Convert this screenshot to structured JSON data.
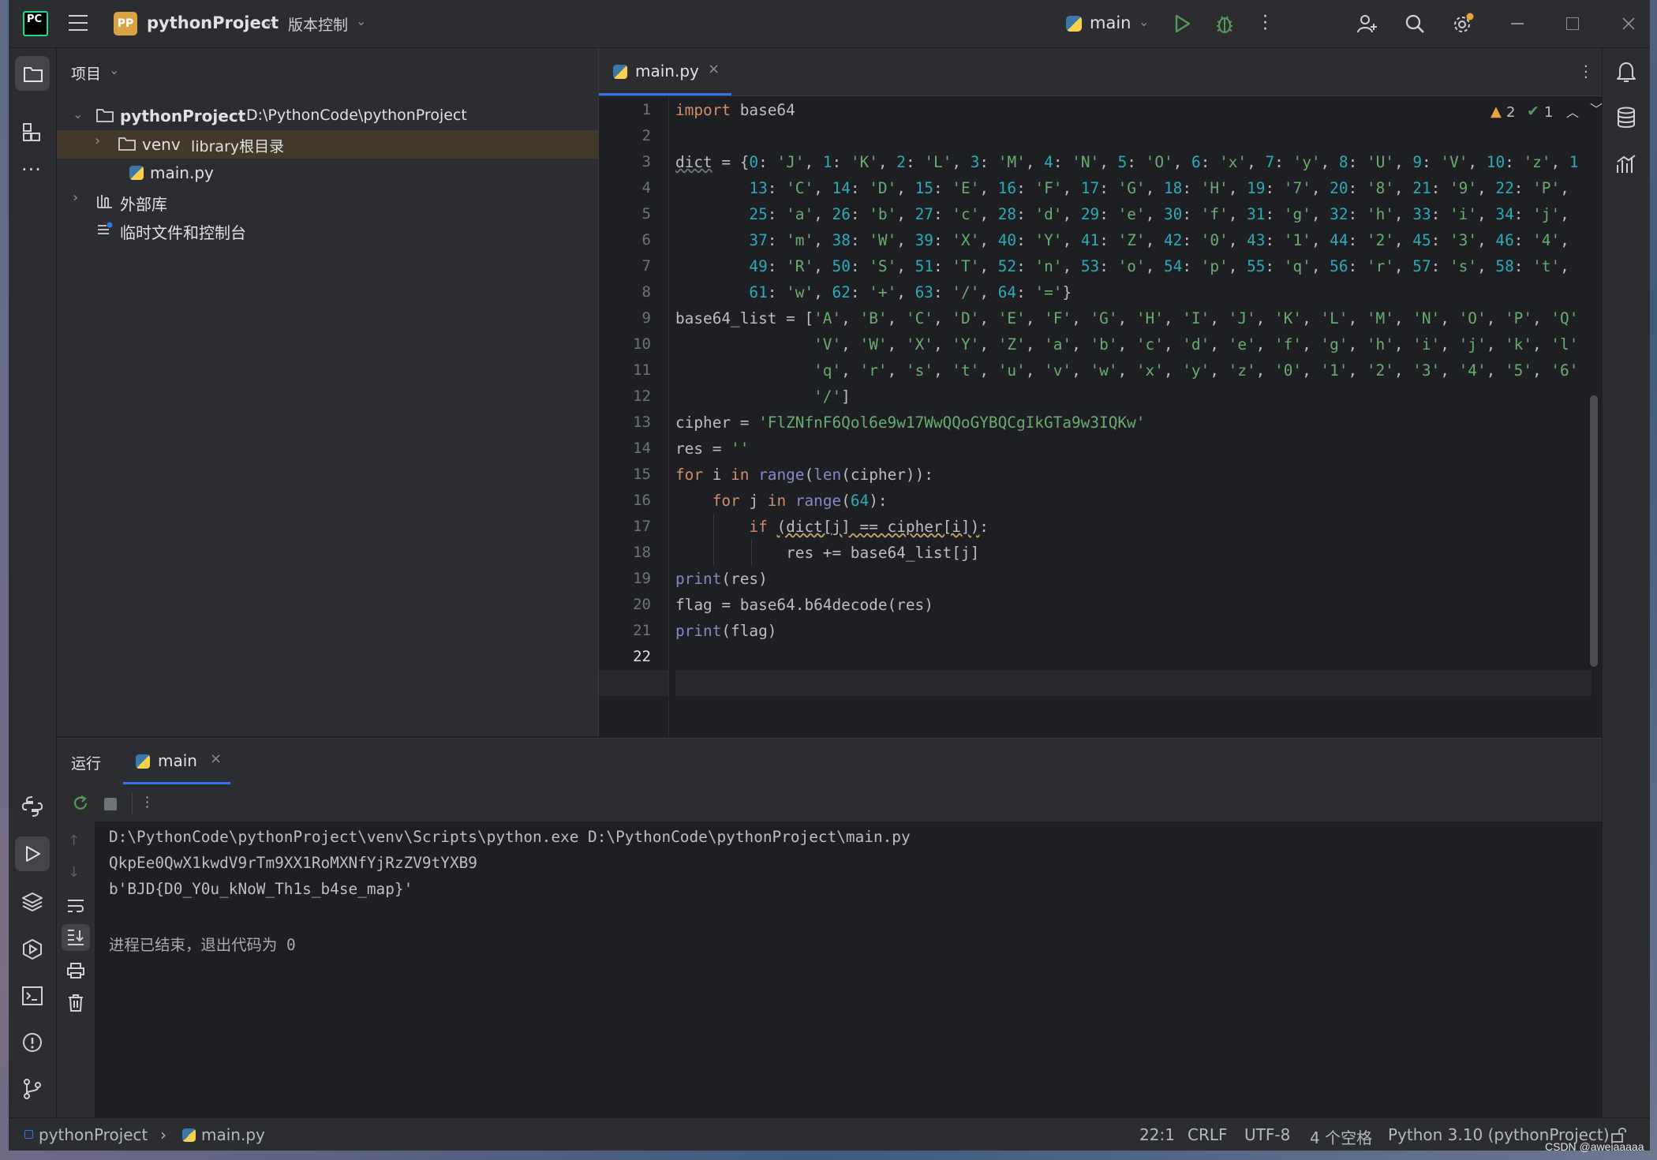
{
  "titlebar": {
    "project_badge": "PP",
    "project_name": "pythonProject",
    "vcs_label": "版本控制",
    "run_config": "main"
  },
  "project_panel": {
    "title": "项目",
    "tree": [
      {
        "label": "pythonProject",
        "hint": "D:\\PythonCode\\pythonProject"
      },
      {
        "label": "venv",
        "hint": "library根目录"
      },
      {
        "label": "main.py",
        "hint": ""
      },
      {
        "label": "外部库",
        "hint": ""
      },
      {
        "label": "临时文件和控制台",
        "hint": ""
      }
    ]
  },
  "editor": {
    "tab_label": "main.py",
    "warnings_count": "2",
    "ok_count": "1",
    "line_numbers": [
      "1",
      "2",
      "3",
      "4",
      "5",
      "6",
      "7",
      "8",
      "9",
      "10",
      "11",
      "12",
      "13",
      "14",
      "15",
      "16",
      "17",
      "18",
      "19",
      "20",
      "21",
      "22"
    ],
    "current_line": "22"
  },
  "run_panel": {
    "tab_run": "运行",
    "tab_main": "main",
    "console_lines": [
      "D:\\PythonCode\\pythonProject\\venv\\Scripts\\python.exe D:\\PythonCode\\pythonProject\\main.py",
      "QkpEe0QwX1kwdV9rTm9XX1RoMXNfYjRzZV9tYXB9",
      "b'BJD{D0_Y0u_kNoW_Th1s_b4se_map}'",
      "",
      "进程已结束，退出代码为 0"
    ]
  },
  "statusbar": {
    "crumb_project": "pythonProject",
    "crumb_file": "main.py",
    "position": "22:1",
    "line_sep": "CRLF",
    "encoding": "UTF-8",
    "indent": "4 个空格",
    "interpreter": "Python 3.10 (pythonProject)"
  },
  "watermark": "CSDN @aweiaaaaa",
  "colors": {
    "accent": "#3574f0",
    "keyword": "#cf8e6d",
    "string": "#6aab73",
    "number": "#2aacb8",
    "function": "#56a8f5",
    "builtin": "#8888c6"
  }
}
